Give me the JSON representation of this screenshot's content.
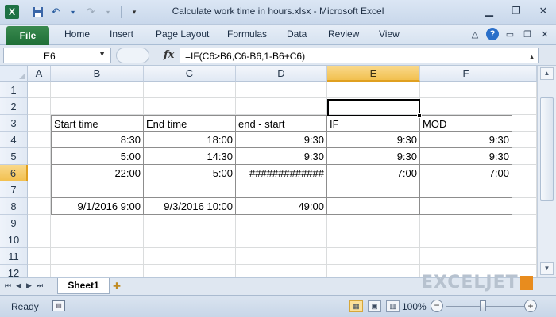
{
  "window": {
    "title": "Calculate work time in hours.xlsx  -  Microsoft Excel"
  },
  "qat": {
    "app_icon": "excel-icon",
    "icons": [
      "save-icon",
      "undo-icon",
      "redo-icon",
      "customize-qat-icon"
    ]
  },
  "ribbon": {
    "file_label": "File",
    "tabs": [
      "Home",
      "Insert",
      "Page Layout",
      "Formulas",
      "Data",
      "Review",
      "View"
    ]
  },
  "formula_bar": {
    "name_box": "E6",
    "fx_label": "fx",
    "formula": "=IF(C6>B6,C6-B6,1-B6+C6)"
  },
  "grid": {
    "columns": [
      "A",
      "B",
      "C",
      "D",
      "E",
      "F"
    ],
    "rows": [
      "1",
      "2",
      "3",
      "4",
      "5",
      "6",
      "7",
      "8",
      "9",
      "10",
      "11",
      "12"
    ],
    "active_column": "E",
    "active_row": "6",
    "header_row": [
      "Start time",
      "End time",
      "end - start",
      "IF",
      "MOD"
    ],
    "data": [
      [
        "8:30",
        "18:00",
        "9:30",
        "9:30",
        "9:30"
      ],
      [
        "5:00",
        "14:30",
        "9:30",
        "9:30",
        "9:30"
      ],
      [
        "22:00",
        "5:00",
        "#############",
        "7:00",
        "7:00"
      ],
      [
        "",
        "",
        "",
        "",
        ""
      ],
      [
        "9/1/2016 9:00",
        "9/3/2016 10:00",
        "49:00",
        "",
        ""
      ]
    ]
  },
  "sheets": {
    "active": "Sheet1"
  },
  "watermark": "EXCELJET",
  "status": {
    "ready": "Ready",
    "zoom": "100%",
    "zoom_level": 1.0
  }
}
